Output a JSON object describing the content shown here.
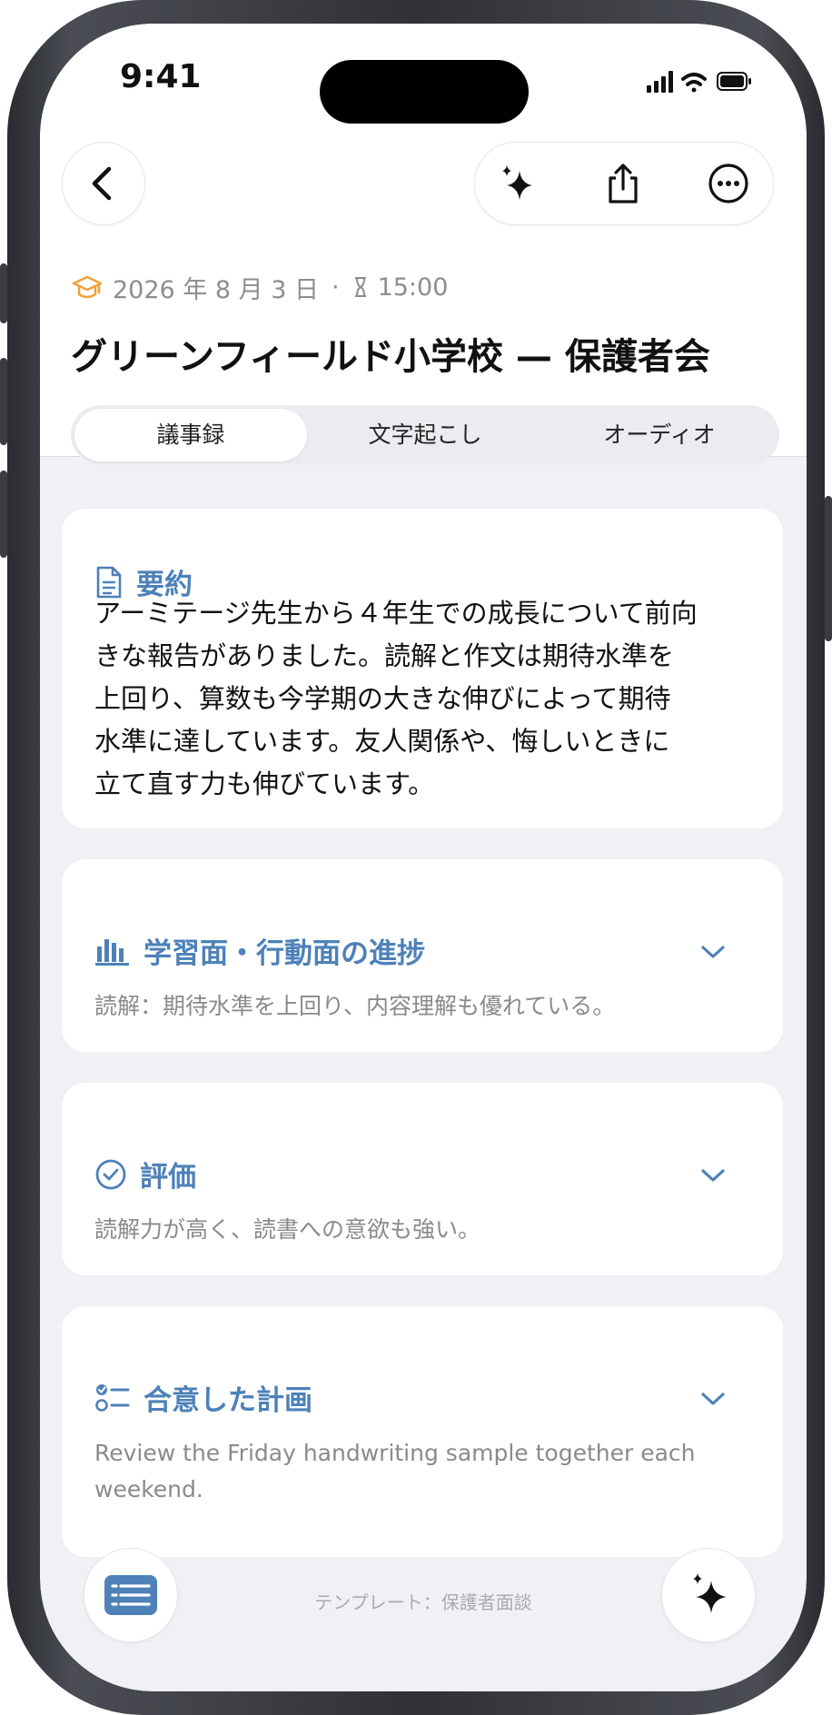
{
  "status_bar": {
    "time": "9:41"
  },
  "toolbar": {
    "back_icon": "chevron-left-icon",
    "ai_icon": "sparkles-icon",
    "share_icon": "share-icon",
    "more_icon": "ellipsis-circle-icon"
  },
  "meeting": {
    "category_icon": "graduation-cap-icon",
    "date": "2026 年 8 月 3 日",
    "separator": "·",
    "time": "15:00",
    "title": "グリーンフィールド小学校 — 保護者会"
  },
  "tabs": [
    {
      "label": "議事録",
      "active": true
    },
    {
      "label": "文字起こし",
      "active": false
    },
    {
      "label": "オーディオ",
      "active": false
    }
  ],
  "summary": {
    "heading": "要約",
    "icon": "document-icon",
    "lines": [
      "アーミテージ先生から４年生での成長について前向",
      "きな報告がありました。読解と作文は期待水準を",
      "上回り、算数も今学期の大きな伸びによって期待",
      "水準に達しています。友人関係や、悔しいときに",
      "立て直す力も伸びています。"
    ]
  },
  "sections": [
    {
      "heading": "学習面・行動面の進捗",
      "icon": "bar-chart-icon",
      "preview": "読解：期待水準を上回り、内容理解も優れている。"
    },
    {
      "heading": "評価",
      "icon": "check-circle-icon",
      "preview": "読解力が高く、読書への意欲も強い。"
    },
    {
      "heading": "合意した計画",
      "icon": "checklist-icon",
      "preview": "Review the Friday handwriting sample together each weekend."
    }
  ],
  "footer": {
    "template_label": "テンプレート：保護者面談",
    "list_icon": "list-icon",
    "ai_icon": "sparkles-icon"
  },
  "colors": {
    "accent": "#4d81b8",
    "category": "#f2a23a",
    "background": "#f0f0f5"
  }
}
